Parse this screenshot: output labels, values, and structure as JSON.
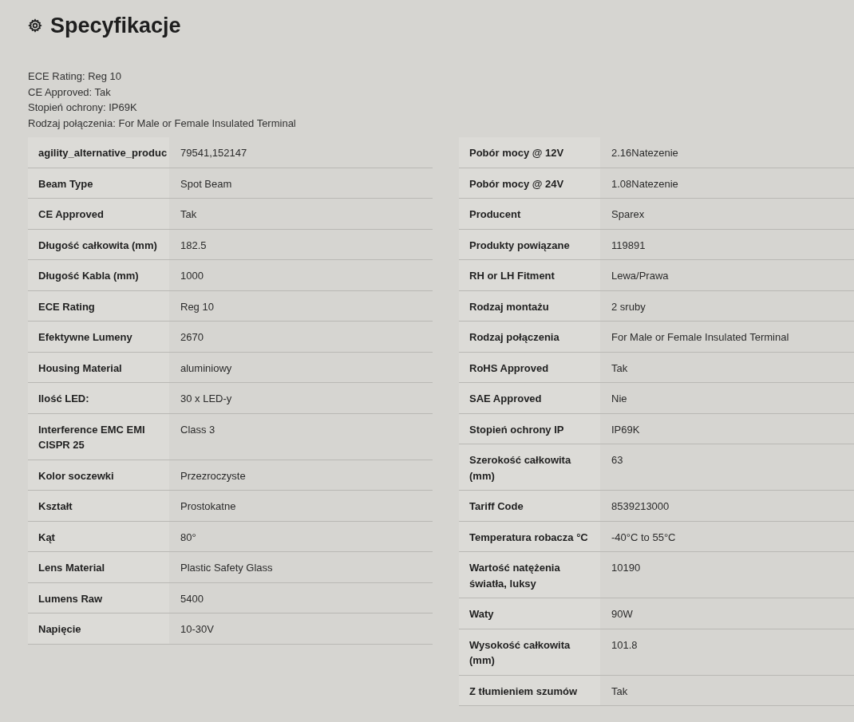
{
  "heading": {
    "title": "Specyfikacje"
  },
  "summary": [
    "ECE Rating: Reg 10",
    "CE Approved: Tak",
    "Stopień ochrony: IP69K",
    "Rodzaj połączenia: For Male or Female Insulated Terminal"
  ],
  "tables": [
    {
      "rows": [
        {
          "label": "agility_alternative_produc",
          "value": "79541,152147"
        },
        {
          "label": "Beam Type",
          "value": "Spot Beam"
        },
        {
          "label": "CE Approved",
          "value": "Tak"
        },
        {
          "label": "Długość całkowita (mm)",
          "value": "182.5"
        },
        {
          "label": "Długość Kabla (mm)",
          "value": "1000"
        },
        {
          "label": "ECE Rating",
          "value": "Reg 10"
        },
        {
          "label": "Efektywne Lumeny",
          "value": "2670"
        },
        {
          "label": "Housing Material",
          "value": "aluminiowy"
        },
        {
          "label": "Ilość LED:",
          "value": "30 x LED-y"
        },
        {
          "label": "Interference EMC EMI CISPR 25",
          "value": "Class 3"
        },
        {
          "label": "Kolor soczewki",
          "value": "Przezroczyste"
        },
        {
          "label": "Kształt",
          "value": "Prostokatne"
        },
        {
          "label": "Kąt",
          "value": "80°"
        },
        {
          "label": "Lens Material",
          "value": "Plastic Safety Glass"
        },
        {
          "label": "Lumens Raw",
          "value": "5400"
        },
        {
          "label": "Napięcie",
          "value": "10-30V"
        }
      ]
    },
    {
      "rows": [
        {
          "label": "Pobór mocy @ 12V",
          "value": "2.16Natezenie"
        },
        {
          "label": "Pobór mocy @ 24V",
          "value": "1.08Natezenie"
        },
        {
          "label": "Producent",
          "value": "Sparex"
        },
        {
          "label": "Produkty powiązane",
          "value": "119891"
        },
        {
          "label": "RH or LH Fitment",
          "value": "Lewa/Prawa"
        },
        {
          "label": "Rodzaj montażu",
          "value": "2 sruby"
        },
        {
          "label": "Rodzaj połączenia",
          "value": "For Male or Female Insulated Terminal"
        },
        {
          "label": "RoHS Approved",
          "value": "Tak"
        },
        {
          "label": "SAE Approved",
          "value": "Nie"
        },
        {
          "label": "Stopień ochrony IP",
          "value": "IP69K"
        },
        {
          "label": "Szerokość całkowita (mm)",
          "value": "63"
        },
        {
          "label": "Tariff Code",
          "value": "8539213000"
        },
        {
          "label": "Temperatura robacza °C",
          "value": "-40°C to 55°C"
        },
        {
          "label": "Wartość natężenia światła, luksy",
          "value": "10190"
        },
        {
          "label": "Waty",
          "value": "90W"
        },
        {
          "label": "Wysokość całkowita (mm)",
          "value": "101.8"
        },
        {
          "label": "Z tłumieniem szumów",
          "value": "Tak"
        }
      ]
    }
  ]
}
